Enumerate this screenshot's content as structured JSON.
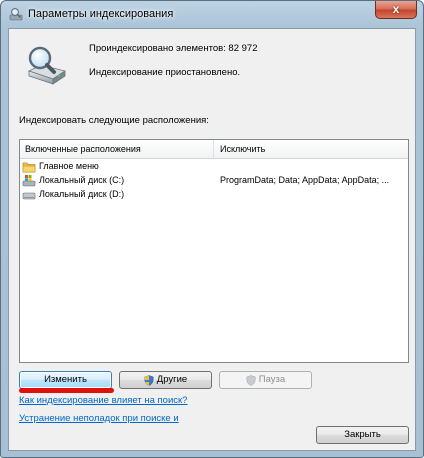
{
  "window": {
    "title": "Параметры индексирования",
    "close_glyph": "x"
  },
  "status": {
    "indexed_count": "Проиндексировано элементов: 82 972",
    "state": "Индексирование приостановлено."
  },
  "locations": {
    "section_label": "Индексировать следующие расположения:",
    "columns": [
      "Включенные расположения",
      "Исключить"
    ],
    "rows": [
      {
        "name": "Главное меню",
        "exclude": "",
        "icon": "folder-icon"
      },
      {
        "name": "Локальный диск (C:)",
        "exclude": "ProgramData; Data; AppData; AppData; ...",
        "icon": "system-drive-icon"
      },
      {
        "name": "Локальный диск (D:)",
        "exclude": "",
        "icon": "drive-icon"
      }
    ]
  },
  "buttons": {
    "change": "Изменить",
    "other": "Другие",
    "pause": "Пауза",
    "close": "Закрыть"
  },
  "links": {
    "how_affects": "Как индексирование влияет на поиск?",
    "troubleshoot": "Устранение неполадок при поиске и"
  },
  "colors": {
    "accent_link": "#0066cc",
    "highlight_underline": "#e0100d"
  }
}
